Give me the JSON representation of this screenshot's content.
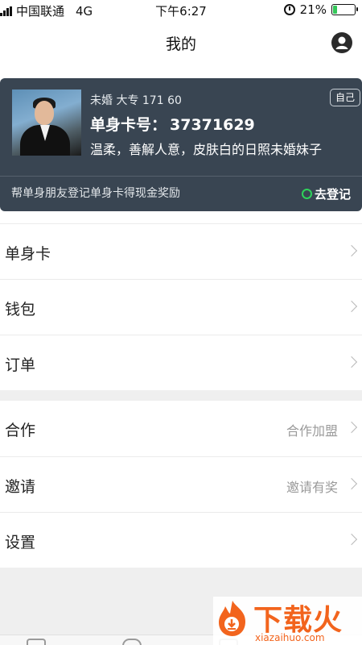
{
  "status_bar": {
    "carrier": "中国联通",
    "network": "4G",
    "time": "下午6:27",
    "battery_percent_text": "21%",
    "battery_level": 0.21,
    "battery_color": "#34c759"
  },
  "header": {
    "title": "我的",
    "profile_icon": "user-circle-icon"
  },
  "card": {
    "background": "#394552",
    "info": "未婚  大专  171  60",
    "self_button": "自己",
    "number_label": "单身卡号：",
    "number_value": "37371629",
    "description": "温柔，善解人意，皮肤白的日照未婚妹子",
    "promo_text": "帮单身朋友登记单身卡得现金奖励",
    "register_label": "去登记",
    "register_dot_color": "#2ed35a"
  },
  "menu": {
    "group1": [
      {
        "label": "单身卡",
        "value": ""
      },
      {
        "label": "钱包",
        "value": ""
      },
      {
        "label": "订单",
        "value": ""
      }
    ],
    "group2": [
      {
        "label": "合作",
        "value": "合作加盟"
      },
      {
        "label": "邀请",
        "value": "邀请有奖"
      },
      {
        "label": "设置",
        "value": ""
      }
    ]
  },
  "watermark": {
    "brand": "下载火",
    "url": "xiazaihuo.com",
    "color": "#f2641d"
  }
}
